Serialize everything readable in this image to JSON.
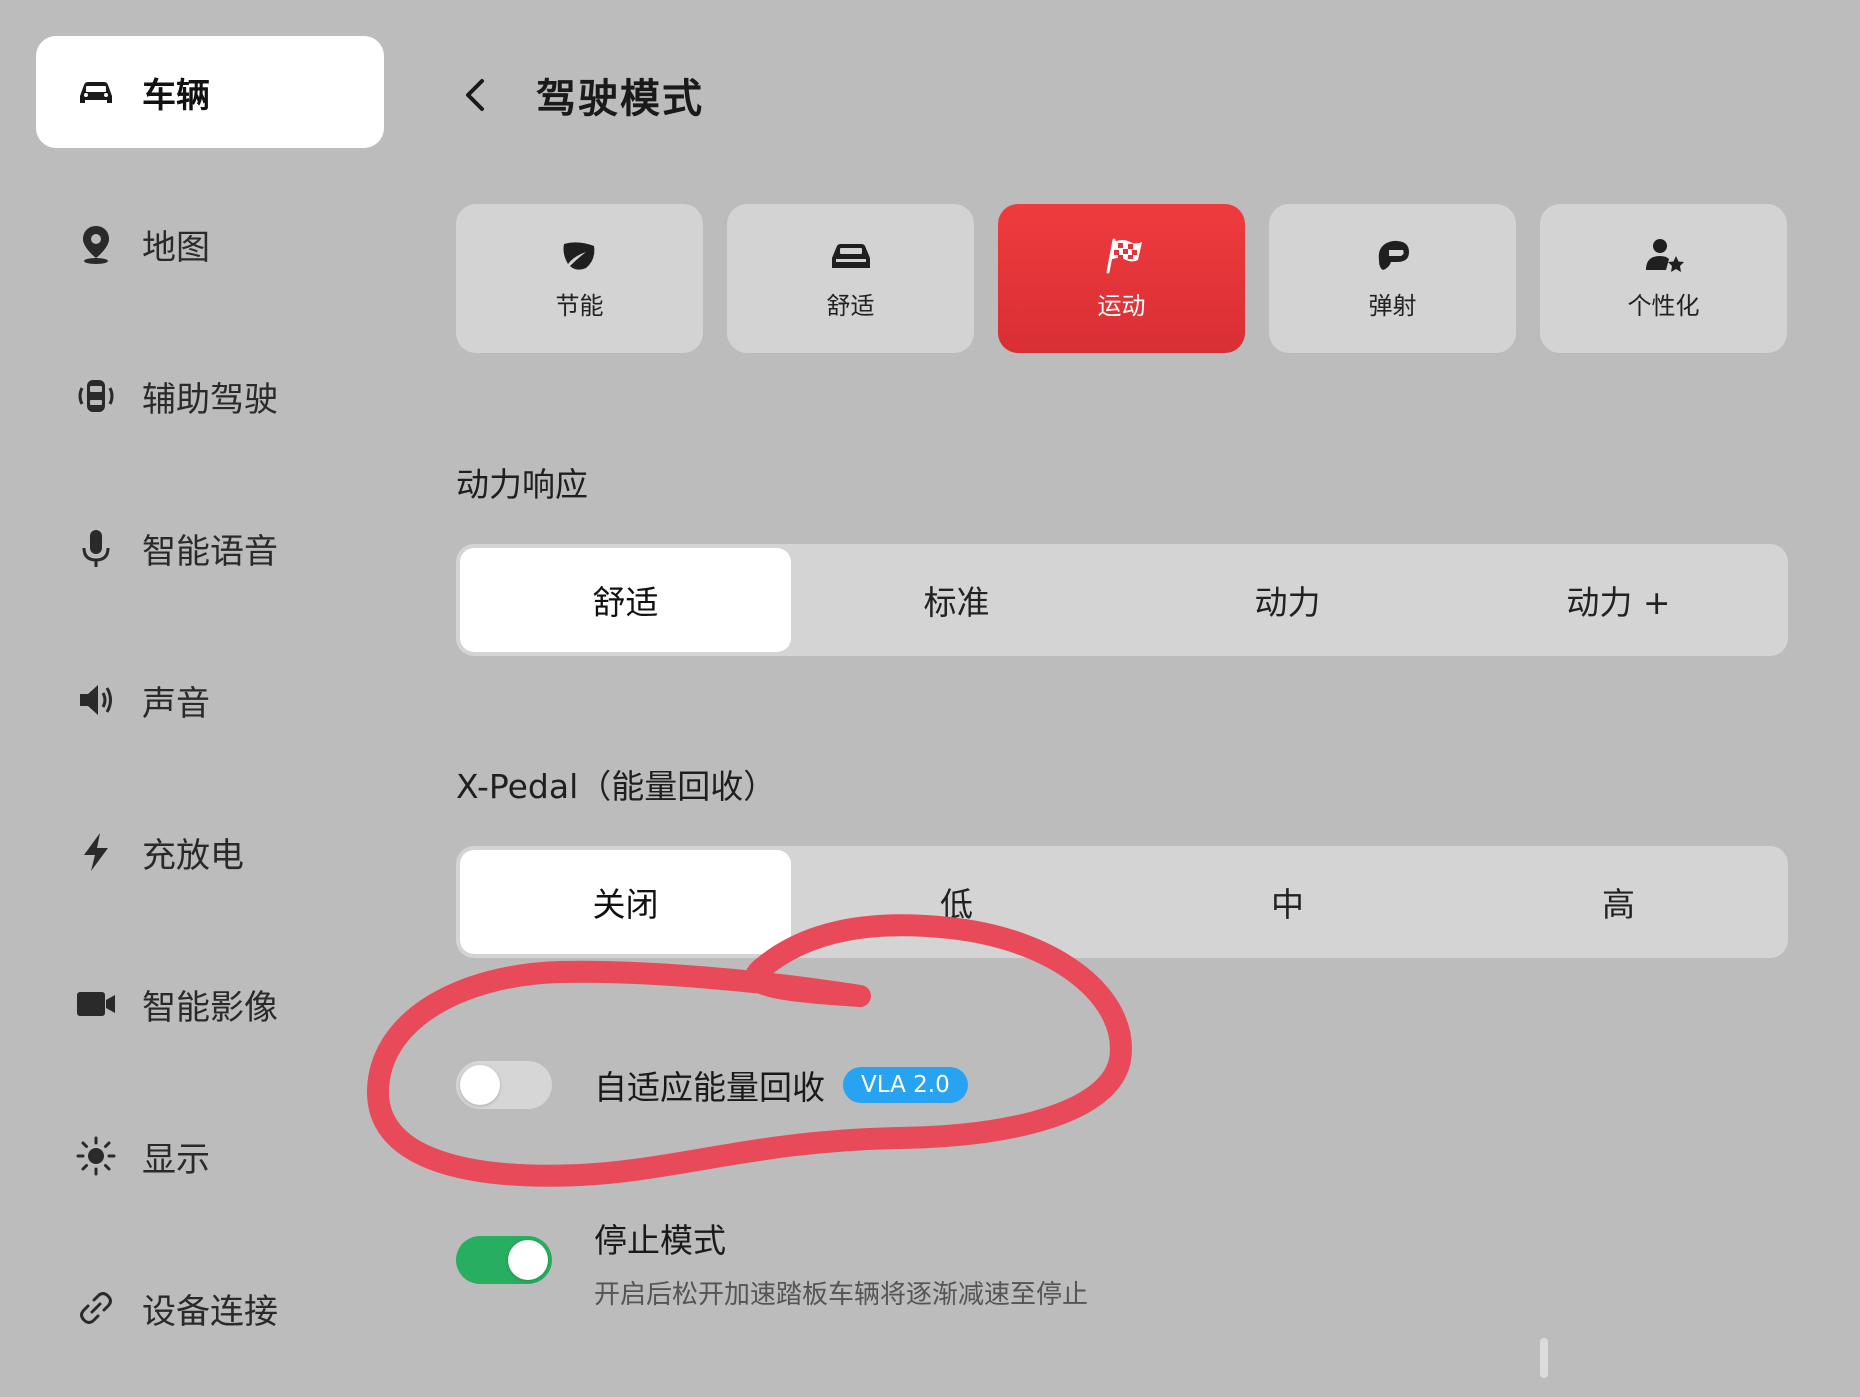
{
  "sidebar": {
    "items": [
      {
        "label": "车辆",
        "icon": "car-icon",
        "active": true
      },
      {
        "label": "地图",
        "icon": "map-pin-icon",
        "active": false
      },
      {
        "label": "辅助驾驶",
        "icon": "assisted-driving-icon",
        "active": false
      },
      {
        "label": "智能语音",
        "icon": "microphone-icon",
        "active": false
      },
      {
        "label": "声音",
        "icon": "speaker-icon",
        "active": false
      },
      {
        "label": "充放电",
        "icon": "lightning-icon",
        "active": false
      },
      {
        "label": "智能影像",
        "icon": "camera-icon",
        "active": false
      },
      {
        "label": "显示",
        "icon": "sun-icon",
        "active": false
      },
      {
        "label": "设备连接",
        "icon": "link-icon",
        "active": false
      }
    ]
  },
  "header": {
    "title": "驾驶模式",
    "back_icon": "chevron-left-icon"
  },
  "modes": {
    "items": [
      {
        "label": "节能",
        "icon": "leaf-icon",
        "active": false
      },
      {
        "label": "舒适",
        "icon": "car-front-icon",
        "active": false
      },
      {
        "label": "运动",
        "icon": "checkered-flag-icon",
        "active": true
      },
      {
        "label": "弹射",
        "icon": "helmet-icon",
        "active": false
      },
      {
        "label": "个性化",
        "icon": "user-star-icon",
        "active": false
      }
    ],
    "accent_color": "#e8383c"
  },
  "power_response": {
    "title": "动力响应",
    "options": [
      "舒适",
      "标准",
      "动力",
      "动力 +"
    ],
    "selected": "舒适"
  },
  "xpedal": {
    "title": "X-Pedal（能量回收）",
    "options": [
      "关闭",
      "低",
      "中",
      "高"
    ],
    "selected": "关闭"
  },
  "adaptive_recovery": {
    "label": "自适应能量回收",
    "badge": "VLA 2.0",
    "enabled": false,
    "badge_color": "#28a3f1"
  },
  "stop_mode": {
    "label": "停止模式",
    "description": "开启后松开加速踏板车辆将逐渐减速至停止",
    "enabled": true,
    "toggle_color": "#27ae60"
  }
}
